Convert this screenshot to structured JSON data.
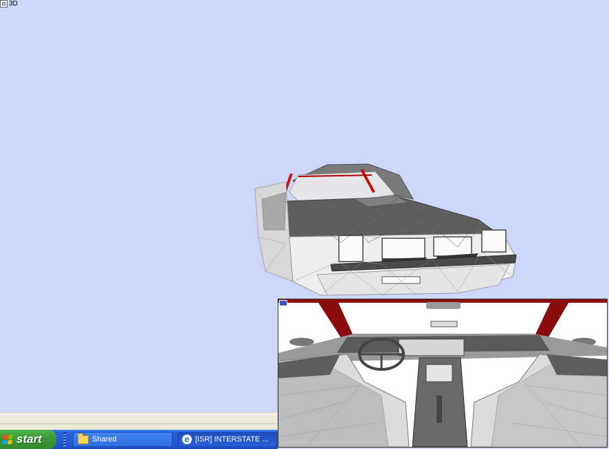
{
  "viewport": {
    "label": "3D",
    "icon": "zoom-icon"
  },
  "colors": {
    "viewport_bg": "#cdd6fb",
    "taskbar": "#2459d6",
    "start": "#3c9a36",
    "model_body": "#6e6e6e",
    "rollcage": "#c81010"
  },
  "taskbar": {
    "start_label": "start",
    "buttons": [
      {
        "label": "Shared",
        "icon": "folder-icon"
      },
      {
        "label": "[ISR] INTERSTATE ...",
        "icon": "ie-icon"
      }
    ]
  }
}
